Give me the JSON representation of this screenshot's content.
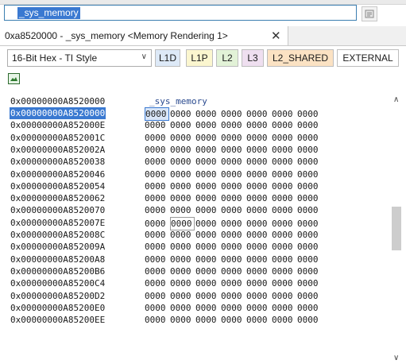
{
  "address_bar": {
    "value": "_sys_memory"
  },
  "tab": {
    "title": "0xa8520000 - _sys_memory <Memory Rendering 1>",
    "close_glyph": "✕"
  },
  "toolbar": {
    "format_select": "16-Bit Hex - TI Style",
    "buttons": [
      {
        "label": "L1D",
        "bg": "#dde9f7"
      },
      {
        "label": "L1P",
        "bg": "#fbf6cf"
      },
      {
        "label": "L2",
        "bg": "#e2f2d7"
      },
      {
        "label": "L3",
        "bg": "#efdff0"
      },
      {
        "label": "L2_SHARED",
        "bg": "#fbe2c3"
      },
      {
        "label": "EXTERNAL",
        "bg": "#ffffff"
      }
    ]
  },
  "memory": {
    "symbol": "_sys_memory",
    "symbol_address": "0x00000000A8520000",
    "rows": [
      {
        "address": "0x00000000A8520000",
        "values": [
          "0000",
          "0000",
          "0000",
          "0000",
          "0000",
          "0000",
          "0000"
        ],
        "highlight": true,
        "selected_col": 0
      },
      {
        "address": "0x00000000A852000E",
        "values": [
          "0000",
          "0000",
          "0000",
          "0000",
          "0000",
          "0000",
          "0000"
        ]
      },
      {
        "address": "0x00000000A852001C",
        "values": [
          "0000",
          "0000",
          "0000",
          "0000",
          "0000",
          "0000",
          "0000"
        ]
      },
      {
        "address": "0x00000000A852002A",
        "values": [
          "0000",
          "0000",
          "0000",
          "0000",
          "0000",
          "0000",
          "0000"
        ]
      },
      {
        "address": "0x00000000A8520038",
        "values": [
          "0000",
          "0000",
          "0000",
          "0000",
          "0000",
          "0000",
          "0000"
        ]
      },
      {
        "address": "0x00000000A8520046",
        "values": [
          "0000",
          "0000",
          "0000",
          "0000",
          "0000",
          "0000",
          "0000"
        ]
      },
      {
        "address": "0x00000000A8520054",
        "values": [
          "0000",
          "0000",
          "0000",
          "0000",
          "0000",
          "0000",
          "0000"
        ]
      },
      {
        "address": "0x00000000A8520062",
        "values": [
          "0000",
          "0000",
          "0000",
          "0000",
          "0000",
          "0000",
          "0000"
        ]
      },
      {
        "address": "0x00000000A8520070",
        "values": [
          "0000",
          "0000",
          "0000",
          "0000",
          "0000",
          "0000",
          "0000"
        ]
      },
      {
        "address": "0x00000000A852007E",
        "values": [
          "0000",
          "0000",
          "0000",
          "0000",
          "0000",
          "0000",
          "0000"
        ],
        "boxed_col": 1
      },
      {
        "address": "0x00000000A852008C",
        "values": [
          "0000",
          "0000",
          "0000",
          "0000",
          "0000",
          "0000",
          "0000"
        ]
      },
      {
        "address": "0x00000000A852009A",
        "values": [
          "0000",
          "0000",
          "0000",
          "0000",
          "0000",
          "0000",
          "0000"
        ]
      },
      {
        "address": "0x00000000A85200A8",
        "values": [
          "0000",
          "0000",
          "0000",
          "0000",
          "0000",
          "0000",
          "0000"
        ]
      },
      {
        "address": "0x00000000A85200B6",
        "values": [
          "0000",
          "0000",
          "0000",
          "0000",
          "0000",
          "0000",
          "0000"
        ]
      },
      {
        "address": "0x00000000A85200C4",
        "values": [
          "0000",
          "0000",
          "0000",
          "0000",
          "0000",
          "0000",
          "0000"
        ]
      },
      {
        "address": "0x00000000A85200D2",
        "values": [
          "0000",
          "0000",
          "0000",
          "0000",
          "0000",
          "0000",
          "0000"
        ]
      },
      {
        "address": "0x00000000A85200E0",
        "values": [
          "0000",
          "0000",
          "0000",
          "0000",
          "0000",
          "0000",
          "0000"
        ]
      },
      {
        "address": "0x00000000A85200EE",
        "values": [
          "0000",
          "0000",
          "0000",
          "0000",
          "0000",
          "0000",
          "0000"
        ]
      }
    ]
  }
}
